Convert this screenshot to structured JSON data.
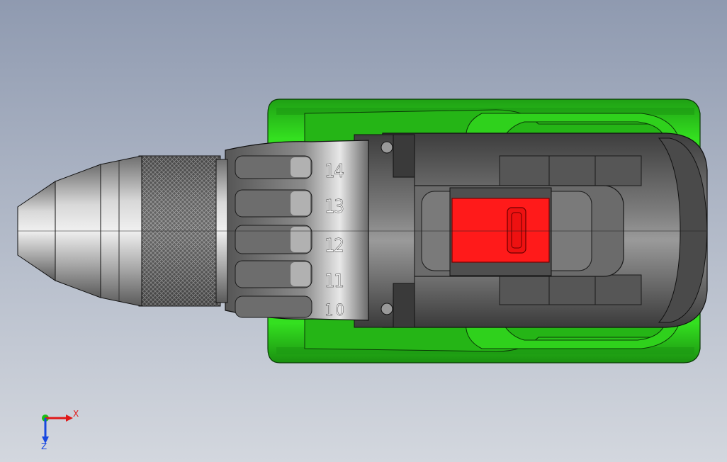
{
  "viewport": {
    "background_top": "#8f9ab0",
    "background_bottom": "#d3d7de"
  },
  "model": {
    "part": "cordless drill (top view)",
    "colors": {
      "body_green": "#2fd11c",
      "dark_green": "#1c9912",
      "grey_shell": "#5b5b5b",
      "chuck_metal": "#b8b8b8",
      "trigger_red": "#ff1a1a"
    },
    "clutch_labels": [
      "14",
      "13",
      "12",
      "11",
      "10"
    ]
  },
  "triad": {
    "x_label": "X",
    "z_label": "Z",
    "x_color": "#e01818",
    "y_color": "#18c018",
    "z_color": "#1848e0"
  }
}
